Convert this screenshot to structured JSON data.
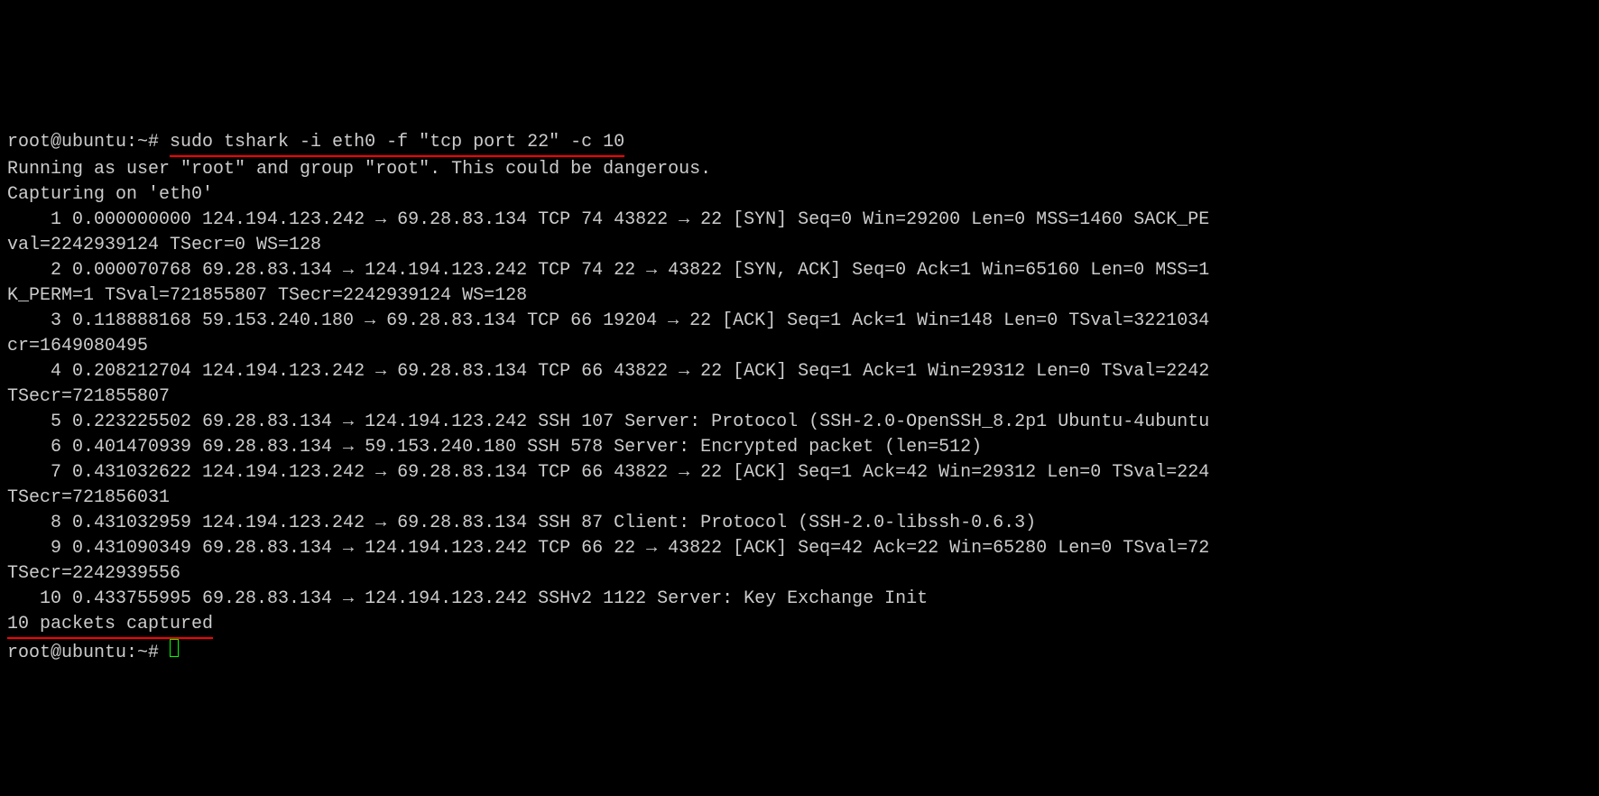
{
  "prompt1": "root@ubuntu:~# ",
  "command": "sudo tshark -i eth0 -f \"tcp port 22\" -c 10",
  "output_lines": [
    "Running as user \"root\" and group \"root\". This could be dangerous.",
    "Capturing on 'eth0'",
    "    1 0.000000000 124.194.123.242 → 69.28.83.134 TCP 74 43822 → 22 [SYN] Seq=0 Win=29200 Len=0 MSS=1460 SACK_PE",
    "val=2242939124 TSecr=0 WS=128",
    "    2 0.000070768 69.28.83.134 → 124.194.123.242 TCP 74 22 → 43822 [SYN, ACK] Seq=0 Ack=1 Win=65160 Len=0 MSS=1",
    "K_PERM=1 TSval=721855807 TSecr=2242939124 WS=128",
    "    3 0.118888168 59.153.240.180 → 69.28.83.134 TCP 66 19204 → 22 [ACK] Seq=1 Ack=1 Win=148 Len=0 TSval=3221034",
    "cr=1649080495",
    "    4 0.208212704 124.194.123.242 → 69.28.83.134 TCP 66 43822 → 22 [ACK] Seq=1 Ack=1 Win=29312 Len=0 TSval=2242",
    "TSecr=721855807",
    "    5 0.223225502 69.28.83.134 → 124.194.123.242 SSH 107 Server: Protocol (SSH-2.0-OpenSSH_8.2p1 Ubuntu-4ubuntu",
    "    6 0.401470939 69.28.83.134 → 59.153.240.180 SSH 578 Server: Encrypted packet (len=512)",
    "    7 0.431032622 124.194.123.242 → 69.28.83.134 TCP 66 43822 → 22 [ACK] Seq=1 Ack=42 Win=29312 Len=0 TSval=224",
    "TSecr=721856031",
    "    8 0.431032959 124.194.123.242 → 69.28.83.134 SSH 87 Client: Protocol (SSH-2.0-libssh-0.6.3)",
    "    9 0.431090349 69.28.83.134 → 124.194.123.242 TCP 66 22 → 43822 [ACK] Seq=42 Ack=22 Win=65280 Len=0 TSval=72",
    "TSecr=2242939556",
    "   10 0.433755995 69.28.83.134 → 124.194.123.242 SSHv2 1122 Server: Key Exchange Init"
  ],
  "summary_line": "10 packets captured",
  "prompt2": "root@ubuntu:~# "
}
